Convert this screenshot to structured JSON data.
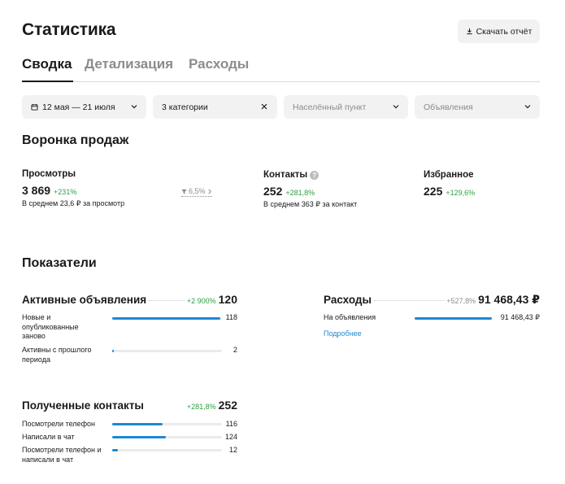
{
  "header": {
    "title": "Статистика",
    "download_label": "Скачать отчёт"
  },
  "tabs": [
    {
      "label": "Сводка",
      "active": true
    },
    {
      "label": "Детализация",
      "active": false
    },
    {
      "label": "Расходы",
      "active": false
    }
  ],
  "filters": {
    "date": "12 мая — 21 июля",
    "categories": "3 категории",
    "location_placeholder": "Населённый пункт",
    "listings_placeholder": "Объявления"
  },
  "funnel": {
    "title": "Воронка продаж",
    "views": {
      "label": "Просмотры",
      "value": "3 869",
      "delta": "+231%",
      "sub": "В среднем 23,6 ₽ за просмотр"
    },
    "conversion": "6,5%",
    "contacts": {
      "label": "Контакты",
      "value": "252",
      "delta": "+281,8%",
      "sub": "В среднем 363 ₽ за контакт"
    },
    "favorites": {
      "label": "Избранное",
      "value": "225",
      "delta": "+129,6%"
    }
  },
  "indicators": {
    "title": "Показатели",
    "active_listings": {
      "title": "Активные объявления",
      "delta": "+2 900%",
      "value": "120",
      "rows": [
        {
          "label": "Новые и опубликованные заново",
          "value": "118",
          "fraction": 0.983
        },
        {
          "label": "Активны с прошлого периода",
          "value": "2",
          "fraction": 0.017
        }
      ]
    },
    "expenses": {
      "title": "Расходы",
      "delta": "+527,8%",
      "value": "91 468,43 ₽",
      "rows": [
        {
          "label": "На объявления",
          "value": "91 468,43 ₽",
          "fraction": 1.0
        }
      ],
      "more_link": "Подробнее"
    },
    "contacts": {
      "title": "Полученные контакты",
      "delta": "+281,8%",
      "value": "252",
      "rows": [
        {
          "label": "Посмотрели телефон",
          "value": "116",
          "fraction": 0.46
        },
        {
          "label": "Написали в чат",
          "value": "124",
          "fraction": 0.49
        },
        {
          "label": "Посмотрели телефон и написали в чат",
          "value": "12",
          "fraction": 0.05
        }
      ]
    }
  },
  "colors": {
    "accent": "#1e88d3",
    "positive": "#2ea043",
    "muted": "#8c8c8c",
    "surface": "#f2f2f2"
  }
}
